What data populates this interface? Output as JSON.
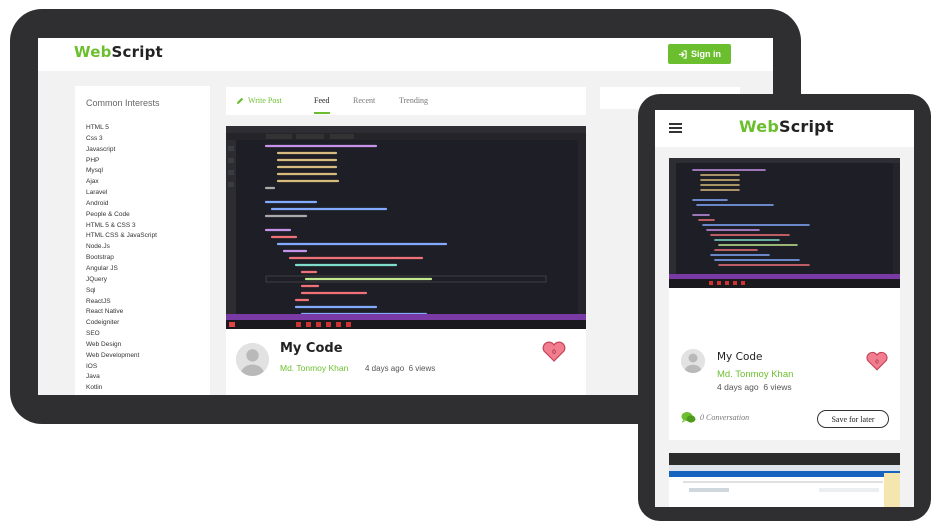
{
  "brand": {
    "name_prefix": "Web",
    "name_suffix": "Script",
    "accent": "#6bbf2f"
  },
  "header": {
    "signin_label": "Sign in"
  },
  "interests": {
    "title": "Common Interests",
    "items": [
      "HTML 5",
      "Css 3",
      "Javascript",
      "PHP",
      "Mysql",
      "Ajax",
      "Laravel",
      "Android",
      "People & Code",
      "HTML 5 & CSS 3",
      "HTML CSS & JavaScript",
      "Node.Js",
      "Bootstrap",
      "Angular JS",
      "JQuery",
      "Sql",
      "ReactJS",
      "React Native",
      "Codeigniter",
      "SEO",
      "Web Design",
      "Web Development",
      "IOS",
      "Java",
      "Kotlin"
    ]
  },
  "tabs": {
    "write": "Write Post",
    "feed": "Feed",
    "recent": "Recent",
    "trending": "Trending"
  },
  "post": {
    "title": "My Code",
    "author": "Md. Tonmoy Khan",
    "time": "4 days ago",
    "views": "6 views"
  },
  "tablet": {
    "conversation": "0 Conversation",
    "save_label": "Save for later"
  }
}
